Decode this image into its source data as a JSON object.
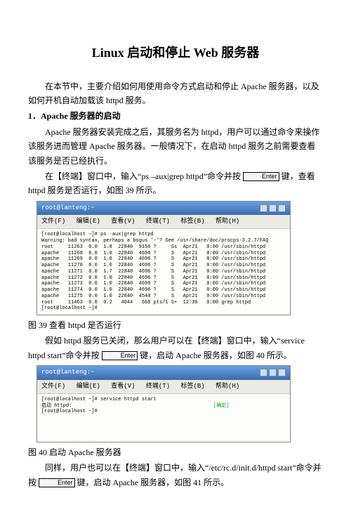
{
  "title": "Linux   启动和停止 Web 服务器",
  "intro1": "在本节中，主要介绍如何用使用命令方式启动和停止 Apache 服务器，以及如何开机自动加载该 httpd 服务。",
  "section1": "1．Apache 服务器的启动",
  "p_start1": "Apache 服务器安装完成之后，其服务名为 httpd，用户可以通过命令来操作该服务进而管理 Apache 服务器。一般情况下，在启动 httpd 服务之前需要查看该服务是否已经执行。",
  "p_cmd1_a": "在【终端】窗口中，输入“ps –aux|grep httpd”命令并按",
  "key_enter": "Enter",
  "p_cmd1_b": "键，查看 httpd 服务是否运行，如图 39 所示。",
  "terminal_title": "root@lanteng:~",
  "menubar": {
    "file": "文件(F)",
    "edit": "编辑(E)",
    "view": "查看(V)",
    "terminal": "终端(T)",
    "tab": "标签(B)",
    "help": "帮助(H)"
  },
  "ps_output": "[root@localhost ~]# ps -aux|grep httpd\nWarning: bad syntax, perhaps a bogus '-'? See /usr/share/doc/procps-3.2.7/FAQ\nroot     11263  0.0  1.8  22840  9156 ?     Ss  Apr21   0:00 /usr/sbin/httpd\napache   11268  0.0  1.0  22840  4696 ?     S   Apr21   0:00 /usr/sbin/httpd\napache   11269  0.0  1.0  22840  4696 ?     S   Apr21   0:00 /usr/sbin/httpd\napache   11270  0.0  1.0  22840  4696 ?     S   Apr21   0:00 /usr/sbin/httpd\napache   11271  0.0  1.7  22840  4696 ?     S   Apr21   0:00 /usr/sbin/httpd\napache   11272  0.0  1.0  22840  4696 ?     S   Apr21   0:00 /usr/sbin/httpd\napache   11273  0.0  1.0  22840  4696 ?     S   Apr21   0:00 /usr/sbin/httpd\napache   11274  0.0  1.0  22840  4696 ?     S   Apr21   0:00 /usr/sbin/httpd\napache   11275  0.0  1.0  22840  4540 ?     S   Apr21   0:00 /usr/sbin/httpd\nroot     11463  0.0  0.2   4044   668 pts/1 S+  12:36   0:00 grep httpd\n[root@localhost ~]#",
  "fig39": "图 39   查看 httpd 是否运行",
  "p_cmd2_a": "假如 httpd 服务已关闭，那么用户可以在【终端】窗口中，输入“service httpd start”命令并按",
  "p_cmd2_b": "键，启动 Apache 服务器，如图 40 所示。",
  "start_output_pre": "[root@localhost ~]# service httpd start\n启动 httpd:                                                ",
  "start_output_ok": "[确定]",
  "start_output_post": "\n[root@localhost ~]#",
  "fig40": "图 40   启动 Apache 服务器",
  "p_cmd3_a": "同样，用户也可以在【终端】窗口中，输入“/etc/rc.d/init.d/httpd start”命令并按",
  "p_cmd3_b": "键，启动 Apache 服务器，如图 41 所示。"
}
